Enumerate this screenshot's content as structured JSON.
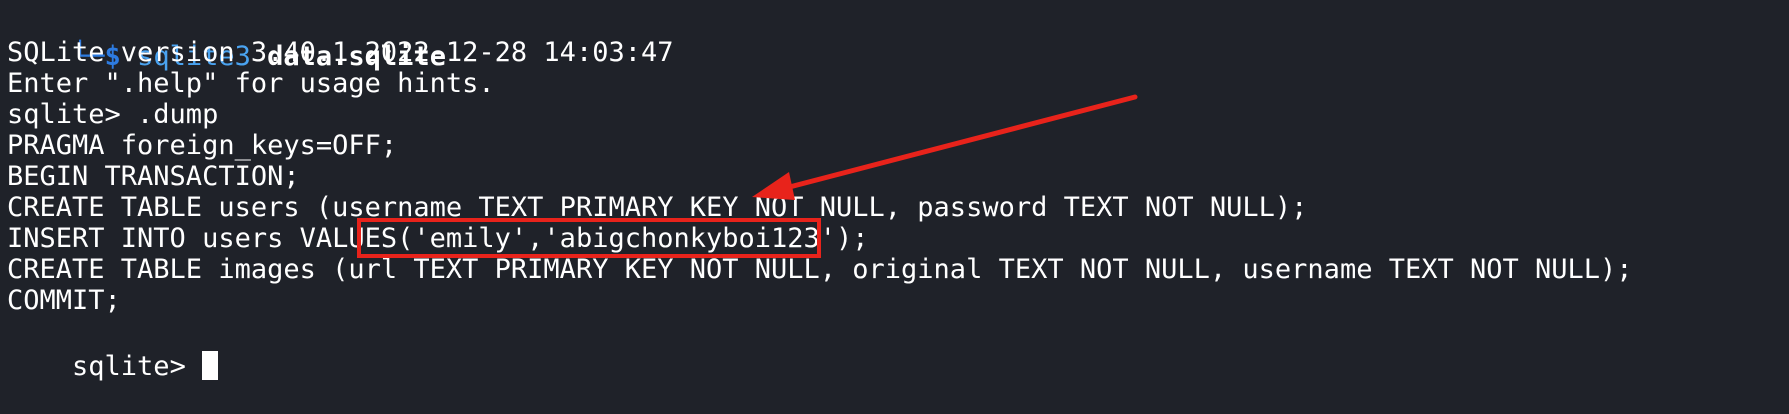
{
  "terminal": {
    "top_partial": "└─",
    "prompt_corner": "└─",
    "prompt_symbol": "$",
    "command_name": "sqlite3",
    "command_arg": "data.sqlite",
    "lines": [
      "SQLite version 3.40.1 2022-12-28 14:03:47",
      "Enter \".help\" for usage hints.",
      "sqlite> .dump",
      "PRAGMA foreign_keys=OFF;",
      "BEGIN TRANSACTION;",
      "CREATE TABLE users (username TEXT PRIMARY KEY NOT NULL, password TEXT NOT NULL);",
      "INSERT INTO users VALUES('emily','abigchonkyboi123');",
      "CREATE TABLE images (url TEXT PRIMARY KEY NOT NULL, original TEXT NOT NULL, username TEXT NOT NULL);",
      "COMMIT;"
    ],
    "final_prompt": "sqlite> "
  },
  "colors": {
    "background": "#1f2229",
    "prompt": "#2d7be0",
    "annotation": "#e8231b"
  }
}
